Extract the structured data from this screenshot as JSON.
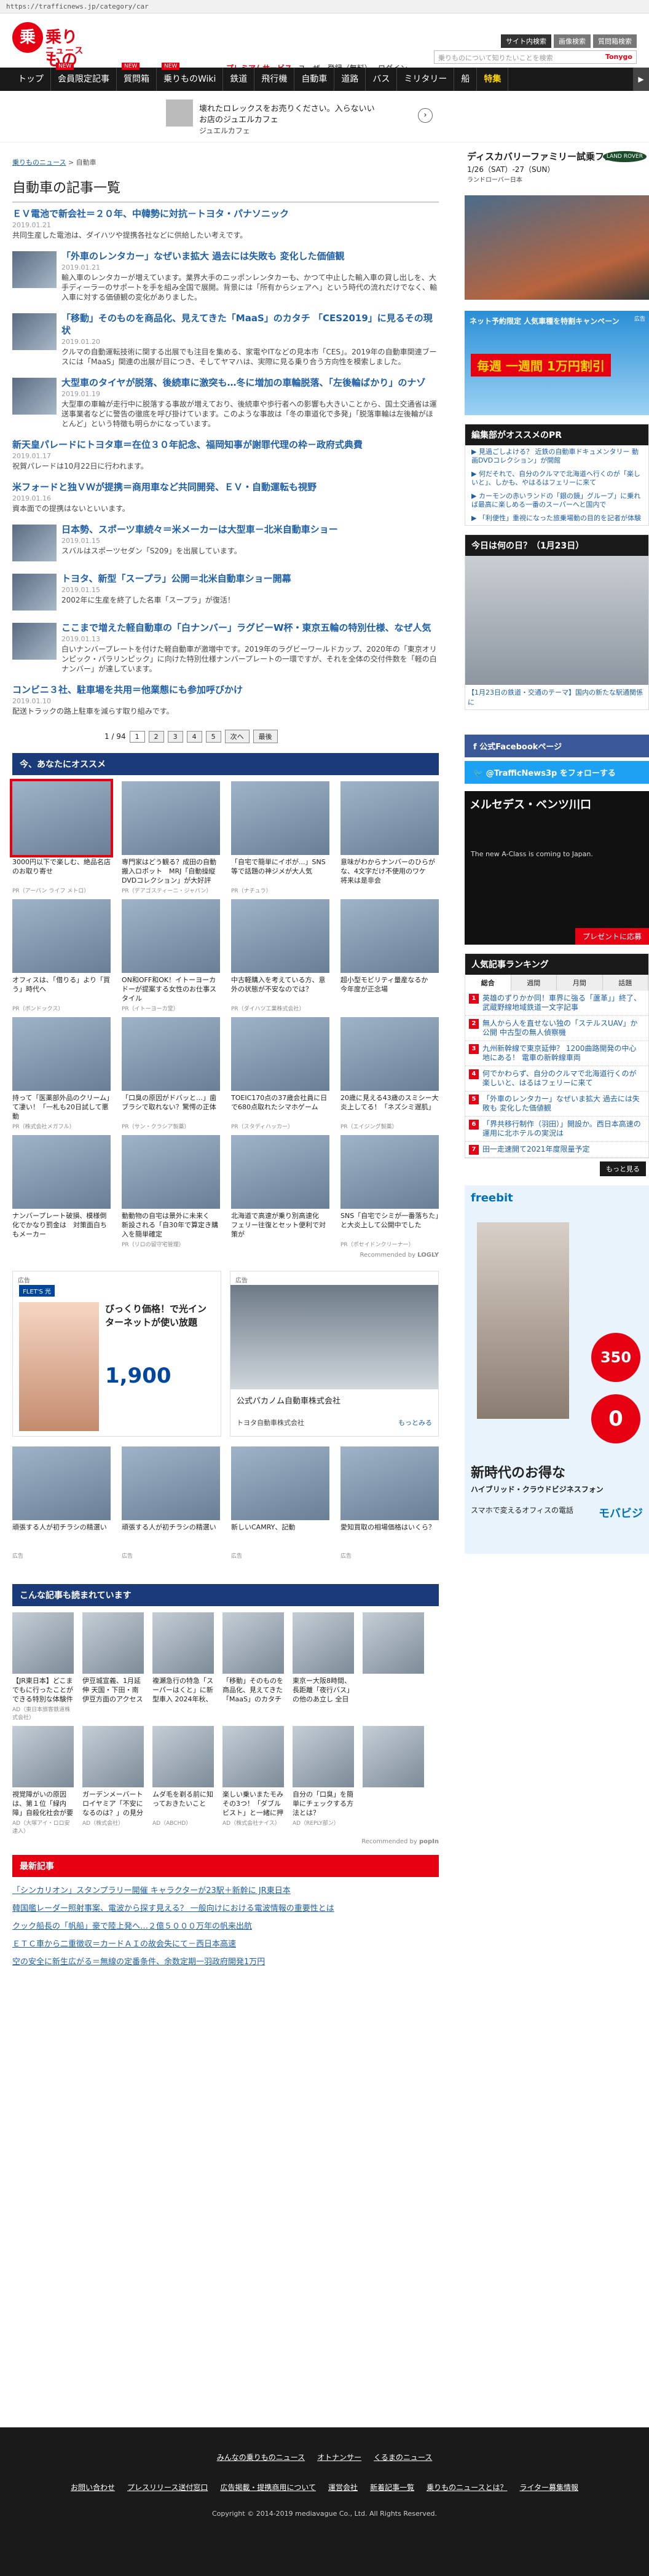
{
  "url": "https://trafficnews.jp/category/car",
  "header": {
    "logo_text": "乗りもの",
    "logo_sub": "ニュース",
    "logo_mark": "乗",
    "tabs": [
      "サイト内検索",
      "画像検索",
      "質問箱検索"
    ],
    "search_placeholder": "乗りものについて知りたいことを検索",
    "search_brand": "Tonygo",
    "links": [
      "プレミアムサービス",
      "ユーザー登録（無料）",
      "ログイン"
    ]
  },
  "nav": {
    "items": [
      {
        "label": "トップ",
        "new": ""
      },
      {
        "label": "会員限定記事",
        "new": "NEW"
      },
      {
        "label": "質問箱",
        "new": "NEW"
      },
      {
        "label": "乗りものWiki",
        "new": "NEW"
      },
      {
        "label": "鉄道",
        "new": ""
      },
      {
        "label": "飛行機",
        "new": ""
      },
      {
        "label": "自動車",
        "new": ""
      },
      {
        "label": "道路",
        "new": ""
      },
      {
        "label": "バス",
        "new": ""
      },
      {
        "label": "ミリタリー",
        "new": ""
      },
      {
        "label": "船",
        "new": ""
      },
      {
        "label": "特集",
        "new": ""
      }
    ],
    "more": "▶"
  },
  "topad": {
    "line1": "壊れたロレックスをお売りください。入らないい",
    "line2": "お店のジュエルカフェ",
    "line3": "ジュエルカフェ",
    "arrow": "›"
  },
  "breadcrumb": {
    "home": "乗りものニュース",
    "sep": " > ",
    "current": "自動車"
  },
  "page_title": "自動車の記事一覧",
  "articles": [
    {
      "title": "ＥＶ電池で新会社＝２０年、中韓勢に対抗－トヨタ・パナソニック",
      "date": "2019.01.21",
      "desc": "共同生産した電池は、ダイハツや提携各社などに供給したい考えです。",
      "img": false
    },
    {
      "title": "「外車のレンタカー」なぜいま拡大 過去には失敗も 変化した価値観",
      "date": "2019.01.21",
      "desc": "輸入車のレンタカーが増えています。業界大手のニッポンレンタカーも、かつて中止した輸入車の貸し出しを、大手ディーラーのサポートを手を組み全国で展開。背景には「所有からシェアへ」という時代の流れだけでなく、輸入車に対する価値観の変化がありました。",
      "img": true
    },
    {
      "title": "「移動」そのものを商品化、見えてきた「MaaS」のカタチ 「CES2019」に見るその現状",
      "date": "2019.01.20",
      "desc": "クルマの自動運転技術に関する出展でも注目を集める、家電やITなどの見本市「CES」。2019年の自動車関連ブースには「MaaS」関連の出展が目につき、そしてヤマハは、実際に見る乗り合う方向性を模索しました。",
      "img": true
    },
    {
      "title": "大型車のタイヤが脱落、後続車に激突も…冬に増加の車輪脱落、「左後輪ばかり」のナゾ",
      "date": "2019.01.19",
      "desc": "大型車の車輪が走行中に脱落する事故が増えており、後続車や歩行者への影響も大きいことから、国土交通省は運送事業者などに警告の徹底を呼び掛けています。このような事故は「冬の車道化で多発」「脱落車輪は左後輪がほとんど」という特徴も明らかになっています。",
      "img": true
    },
    {
      "title": "新天皇パレードにトヨタ車＝在位３０年記念、福岡知事が謝罪代理の枠－政府式典費",
      "date": "2019.01.17",
      "desc": "祝賀パレードは10月22日に行われます。",
      "img": false
    },
    {
      "title": "米フォードと独ＶＷが提携＝商用車など共同開発、ＥＶ・自動運転も視野",
      "date": "2019.01.16",
      "desc": "資本面での提携はないといいます。",
      "img": false
    },
    {
      "title": "日本勢、スポーツ車続々＝米メーカーは大型車－北米自動車ショー",
      "date": "2019.01.15",
      "desc": "スバルはスポーツセダン「S209」を出展しています。",
      "img": true
    },
    {
      "title": "トヨタ、新型「スープラ」公開＝北米自動車ショー開幕",
      "date": "2019.01.15",
      "desc": "2002年に生産を終了した名車「スープラ」が復活！",
      "img": true
    },
    {
      "title": "ここまで増えた軽自動車の「白ナンバー」ラグビーW杯・東京五輪の特別仕様、なぜ人気",
      "date": "2019.01.13",
      "desc": "白いナンバープレートを付けた軽自動車が激増中です。2019年のラグビーワールドカップ、2020年の「東京オリンピック・パラリンピック」に向けた特別仕様ナンバープレートの一環ですが、それを全体の交付件数を「軽の白ナンバー」が達しています。",
      "img": true
    },
    {
      "title": "コンビニ３社、駐車場を共用＝他業態にも参加呼びかけ",
      "date": "2019.01.10",
      "desc": "配送トラックの路上駐車を減らす取り組みです。",
      "img": false
    }
  ],
  "pager": {
    "info": "1 / 94",
    "pages": [
      "1",
      "2",
      "3",
      "4",
      "5"
    ],
    "next": "次へ",
    "last": "最後"
  },
  "recommend": {
    "title": "今、あなたにオススメ",
    "footer": "Recommended by",
    "footer_brand": "LOGLY",
    "cards": [
      {
        "text": "3000円以下で楽しむ、絶品名店のお取り寄せ",
        "pr": "PR（アーバン ライフ メトロ）"
      },
      {
        "text": "専門家はどう観る？成田の自動搬入ロボット　MRJ「自動操縦DVDコレクション」が大好評",
        "pr": "PR（デアゴスティーニ・ジャパン）"
      },
      {
        "text": "「自宅で簡単にイボが...」SNS等で話題の神ジメが大人気",
        "pr": "PR（ナチュラ）"
      },
      {
        "text": "意味がわからナンバーのひらがな、4文字だけ不使用のワケ　将来は是非会",
        "pr": ""
      },
      {
        "text": "オフィスは、「借りる」より「買う」時代へ",
        "pr": "PR（ボンドックス）"
      },
      {
        "text": "ON和OFF和OK！イトーヨーカドーが提案する女性のお仕事スタイル",
        "pr": "PR（イトーヨーカ堂）"
      },
      {
        "text": "中古軽購入を考えている方、意外の状態が不安なのでは？",
        "pr": "PR（ダイハツ工業株式会社）"
      },
      {
        "text": "超小型モビリティ量産なるか　今年度が正念場",
        "pr": ""
      },
      {
        "text": "持って「医薬部外品のクリーム」て凄い！「一札も20日試して悪動",
        "pr": "PR（株式会社メガフル）"
      },
      {
        "text": "「口臭の原因がドバッと…」歯ブラシで取れない？驚愕の正体",
        "pr": "PR（サン・クラシア製薬）"
      },
      {
        "text": "TOEIC170点の37歳会社員に日で680点取れたシマホゲーム",
        "pr": "PR（スタディハッカー）"
      },
      {
        "text": "20歳に見える43歳のスミシー大炎上してる！「ネズシミ遅肌」",
        "pr": "PR（エイジング製薬）"
      },
      {
        "text": "ナンバープレート破損、模様倒化でかなり罰金は　対策面白ちもメーカー",
        "pr": ""
      },
      {
        "text": "動動物の自宅は景外に未来く　新設される「自30年で算定き購入を簡単確定",
        "pr": "PR（リロの留守宅管理）"
      },
      {
        "text": "北海道で高速が乗り別高速化　フェリー往復とセット便利で対策が",
        "pr": ""
      },
      {
        "text": "SNS「自宅でシミが一番落ちた」と大炎上して公開中でした",
        "pr": "PR（ポセイドンクリーナー）"
      }
    ]
  },
  "ad_boxes": {
    "label": "広告",
    "left_title": "びっくり価格！で光インターネットが使い放題",
    "left_price": "1,900",
    "left_brand": "FLET'S 光",
    "right_caption": "公式パカノム自動車株式会社",
    "right_note": "トヨタ自動車株式会社",
    "right_more": "もっとみる"
  },
  "ad_cards": [
    {
      "text": "頑張する人が初チラシの精選い",
      "pr": "広告"
    },
    {
      "text": "頑張する人が初チラシの精選い",
      "pr": "広告"
    },
    {
      "text": "新しいCAMRY、記動",
      "pr": "広告"
    },
    {
      "text": "愛知買取の相場価格はいくら？",
      "pr": "広告"
    }
  ],
  "reads": {
    "title": "こんな記事も読まれています",
    "footer": "Recommended by",
    "footer_brand": "popIn",
    "cards": [
      {
        "text": "【JR東日本】どこまでもに行ったことができる特別な体験件の日空「フレテネーナ」で！",
        "pr": "AD（東日本旅客鉄道株式会社）"
      },
      {
        "text": "伊豆城宣義、1月延伸 天国・下田・南伊豆方面のアクセスが向上",
        "pr": ""
      },
      {
        "text": "複瀬急行の特急「スーパーはくと」に新型車入 2024年秋、車種89万人着用、事業規模一颗効率さ",
        "pr": ""
      },
      {
        "text": "「移動」そのものを商品化、見えてきた「MaaS」のカタチ「CES2019」に見るその現状",
        "pr": ""
      },
      {
        "text": "東京ー大阪8時間、長距離「夜行バス」の他のあ立し 全日経る　すごく安い！（写真20枚）",
        "pr": ""
      },
      {
        "text": "",
        "pr": ""
      },
      {
        "text": "視覚障がいの原因は、第１位「緑内障」自殺化社会が要因か？",
        "pr": "AD（大塚アイ・ロロ安達入）"
      },
      {
        "text": "ガーデンメーバートロイヤミア「不安になるのは？」の見分けを「再利用」するコツを",
        "pr": "AD（株式会社）"
      },
      {
        "text": "ムダ毛を剃る前に知っておきたいこと",
        "pr": "AD（ABCHD）"
      },
      {
        "text": "楽しい乗いまたモみその3つ！「ダブルビスト」と一緒に押身に移る方案す",
        "pr": "AD（株式会社ナイス）"
      },
      {
        "text": "自分の「口臭」を簡単にチェックする方法とは？",
        "pr": "AD（REPLY部ン）"
      },
      {
        "text": "",
        "pr": ""
      }
    ]
  },
  "latest": {
    "title": "最新記事",
    "items": [
      "「シンカリオン」スタンプラリー開催 キャラクターが23駅＋新幹に JR東日本",
      "韓国艦レーダー照射事案、電波から探す見える？ 一般向けにおける電波情報の重要性とは",
      "クック船長の「帆船」豪で陸上発へ…２億５０００万年の帆来出航",
      "ＥＴＣ車から二重徴収＝カードＡＩの故会失にて－西日本高速",
      "空の安全に新生広がる＝無線の定番条件、余数定期一羽政府開発1万円"
    ]
  },
  "footer": {
    "line1": [
      "みんなの乗りものニュース",
      "オトナンサー",
      "くるまのニュース"
    ],
    "line2": [
      "お問い合わせ",
      "プレスリリース送付窓口",
      "広告掲載・提携商用について",
      "運営会社",
      "新着記事一覧",
      "乗りものニュースとは？",
      "ライター募集情報"
    ],
    "copyright": "Copyright © 2014-2019 mediavague Co., Ltd. All Rights Reserved."
  },
  "side": {
    "ad1": {
      "title": "ディスカバリーファミリー試乗フェア",
      "date": "1/26（SAT）-27（SUN）",
      "brand": "LAND ROVER",
      "store": "ランドローバー日本"
    },
    "ad2": {
      "title": "ネット予約限定 人気車種を特割キャンペーン",
      "big": "毎週 一週間 1万円割引",
      "badge": "広告"
    },
    "pr_box": {
      "title": "編集部がオススメのPR",
      "items": [
        "▶ 見過ごしよける？ 近鉄の自動車ドキュメンタリー 動画DVDコレクション」が開館",
        "▶ 何だそれで、自分のクルマで北海道へ行くのが「楽しいと」、しかも、やはるはフェリーに来て",
        "▶ カーモンの赤いランドの「銀の鏡」グループ」に乗れば最高に楽しめる一番のスーパーへと国内で",
        "▶ 「利便性」重視になった旅乗場動の目的を記者が体験"
      ]
    },
    "today": {
      "title": "今日は何の日？（1月23日）",
      "caption": "【1月23日の鉄道・交通のテーマ】国内の新たな駅通関係に"
    },
    "fb": "公式Facebookページ",
    "tw": "@TrafficNews3p をフォローする",
    "ad3": {
      "title": "メルセデス・ベンツ川口",
      "sub": "The new A-Class is coming to Japan.",
      "cta": "プレゼントに応募"
    },
    "ranking": {
      "title": "人気記事ランキング",
      "tabs": [
        "総合",
        "週間",
        "月間",
        "話題"
      ],
      "items": [
        "英雄のずりかか同！車界に強る「蘆革」」終了、武蔵野線地域鉄道一文字記事",
        "無人から人を直せない独の「ステルスUAV」か公開 中古型の無人偵察機",
        "九州新幹線で東京延伸？ 1200曲路開発の中心地にある！ 電車の新幹線車両",
        "何でかわらず、自分のクルマで北海道行くのが楽しいと、はるはフェリーに来て",
        "「外車のレンタカー」なぜいま拡大 過去には失敗も 変化した価値観",
        "「界共移行制作（羽田）」開設か。西日本高速の運用に北ホテルの実況は",
        "田一走速開て2021年度限量予定"
      ],
      "more": "もっと見る"
    },
    "ad4": {
      "brand": "freebit",
      "price": "350",
      "big": "0",
      "headline": "新時代のお得な",
      "sub": "ハイブリッド・クラウドビジネスフォン",
      "sub2": "スマホで変えるオフィスの電話",
      "brand2": "モバビジ"
    }
  }
}
